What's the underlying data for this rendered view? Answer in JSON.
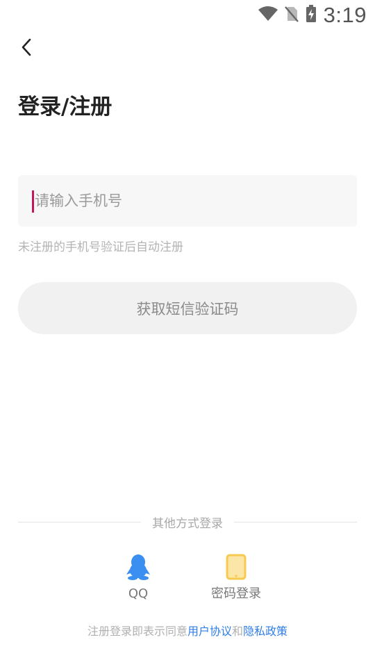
{
  "status_bar": {
    "time": "3:19",
    "icons": [
      "wifi-icon",
      "no-sim-icon",
      "battery-charging-icon"
    ]
  },
  "header": {
    "back_icon": "chevron-left-icon",
    "title": "登录/注册"
  },
  "phone_input": {
    "value": "",
    "placeholder": "请输入手机号"
  },
  "hint": "未注册的手机号验证后自动注册",
  "sms_button": {
    "label": "获取短信验证码"
  },
  "other_login": {
    "divider_label": "其他方式登录",
    "options": [
      {
        "label": "QQ",
        "icon": "qq-penguin-icon",
        "color": "#3b8ff0"
      },
      {
        "label": "密码登录",
        "icon": "tablet-icon",
        "color": "#f7ca4f"
      }
    ]
  },
  "agreement": {
    "prefix": "注册登录即表示同意",
    "user_agreement": "用户协议",
    "conjunction": "和",
    "privacy_policy": "隐私政策",
    "link_color": "#2f7ee8"
  },
  "colors": {
    "cursor": "#c2185b",
    "input_bg": "#f7f7f7",
    "button_bg": "#f1f1f1"
  }
}
